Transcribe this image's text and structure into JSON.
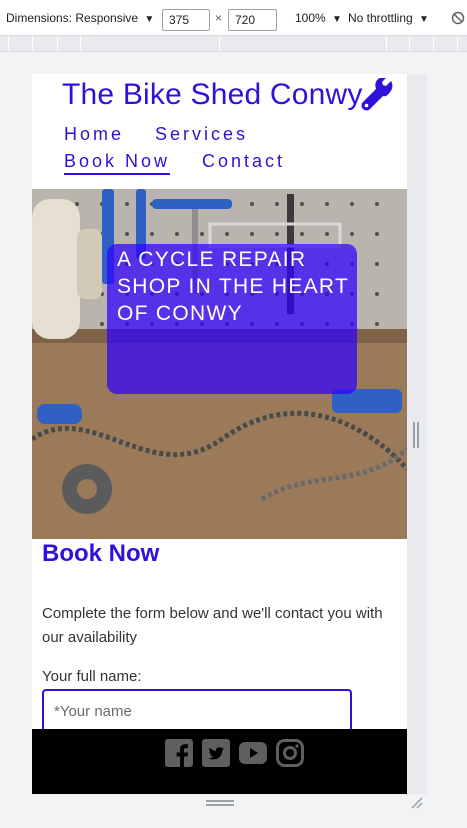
{
  "devtools": {
    "dimensions_label": "Dimensions: Responsive",
    "width_value": "375",
    "times_sign": "×",
    "height_value": "720",
    "zoom_label": "100%",
    "throttling_label": "No throttling",
    "dropdown_arrow": "▼"
  },
  "site": {
    "title": "The Bike Shed Conwy",
    "brand_color": "#2e12d9",
    "logo_icon": "wrench-icon",
    "nav": [
      {
        "label": "Home",
        "active": false
      },
      {
        "label": "Services",
        "active": false
      },
      {
        "label": "Book Now",
        "active": true
      },
      {
        "label": "Contact",
        "active": false
      }
    ]
  },
  "hero": {
    "tagline": "A CYCLE REPAIR SHOP IN THE HEART OF CONWY",
    "overlay_color": "#2e00ff"
  },
  "booking": {
    "heading": "Book Now",
    "intro": "Complete the form below and we'll contact you with our availability",
    "name_label": "Your full name:",
    "name_placeholder": "*Your name",
    "name_value": ""
  },
  "footer": {
    "background": "#000000",
    "icon_color": "#5f5f5f",
    "social_icons": [
      "facebook-icon",
      "twitter-icon",
      "youtube-icon",
      "instagram-icon"
    ]
  }
}
